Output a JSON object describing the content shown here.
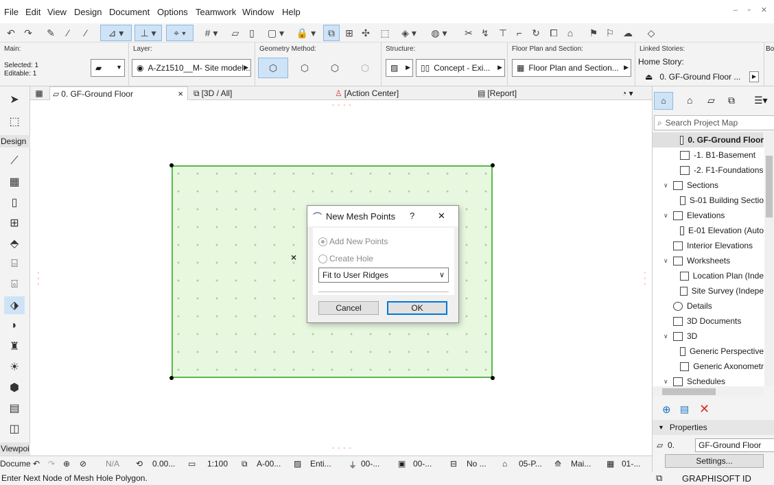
{
  "menu": [
    "File",
    "Edit",
    "View",
    "Design",
    "Document",
    "Options",
    "Teamwork",
    "Window",
    "Help"
  ],
  "infobox": {
    "main_label": "Main:",
    "selected": "Selected: 1",
    "editable": "Editable: 1",
    "layer_label": "Layer:",
    "layer_value": "A-Zz1510__M- Site model...",
    "geometry_label": "Geometry Method:",
    "structure_label": "Structure:",
    "structure_value": "Concept - Exi...",
    "fps_label": "Floor Plan and Section:",
    "fps_value": "Floor Plan and Section...",
    "linked_label": "Linked Stories:",
    "home_story_label": "Home Story:",
    "home_story_value": "0. GF-Ground Floor ...",
    "bot_label": "Bot"
  },
  "tabs": [
    {
      "label": "0. GF-Ground Floor",
      "close": "×"
    },
    {
      "label": "3D / All"
    },
    {
      "label": "Action Center"
    },
    {
      "label": "Report"
    }
  ],
  "left_tools": {
    "design_label": "Design",
    "viewpoint_label": "Viewpoi"
  },
  "dialog": {
    "title": "New Mesh Points",
    "help": "?",
    "close": "✕",
    "opt_add": "Add New Points",
    "opt_hole": "Create Hole",
    "select_value": "Fit to User Ridges",
    "cancel": "Cancel",
    "ok": "OK"
  },
  "canvas": {
    "cursor": "×"
  },
  "navigator": {
    "search_placeholder": "Search Project Map",
    "rows": [
      {
        "label": "0. GF-Ground Floor",
        "indent": 3,
        "sel": true
      },
      {
        "label": "-1. B1-Basement",
        "indent": 3
      },
      {
        "label": "-2. F1-Foundations",
        "indent": 3
      },
      {
        "label": "Sections",
        "indent": 2,
        "chev": "∨"
      },
      {
        "label": "S-01 Building Sectio",
        "indent": 3
      },
      {
        "label": "Elevations",
        "indent": 2,
        "chev": "∨"
      },
      {
        "label": "E-01 Elevation (Auto",
        "indent": 3
      },
      {
        "label": "Interior Elevations",
        "indent": 2
      },
      {
        "label": "Worksheets",
        "indent": 2,
        "chev": "∨"
      },
      {
        "label": "Location Plan (Inde",
        "indent": 3
      },
      {
        "label": "Site Survey (Indepe",
        "indent": 3
      },
      {
        "label": "Details",
        "indent": 2
      },
      {
        "label": "3D Documents",
        "indent": 2
      },
      {
        "label": "3D",
        "indent": 2,
        "chev": "∨"
      },
      {
        "label": "Generic Perspective",
        "indent": 3
      },
      {
        "label": "Generic Axonometr",
        "indent": 3
      },
      {
        "label": "Schedules",
        "indent": 2,
        "chev": "∨"
      }
    ],
    "properties_label": "Properties",
    "prop_id": "0.",
    "prop_name": "GF-Ground Floor",
    "settings": "Settings..."
  },
  "status": {
    "na": "N/A",
    "angle": "0.00...",
    "scale": "1:100",
    "layer_combo": "A-00...",
    "entire": "Enti...",
    "pen": "00-...",
    "model": "00-...",
    "override": "No ...",
    "renov": "05-P...",
    "mvo": "Mai...",
    "dim": "01-...",
    "docu": "Docume"
  },
  "prompt": "Enter Next Node of Mesh Hole Polygon.",
  "graphisoft_id": "GRAPHISOFT ID",
  "colors": {
    "accent": "#0078d7",
    "mesh_fill": "#e8f8e0",
    "mesh_edge": "#57b84a",
    "selected_tool": "#cfe3f7"
  }
}
